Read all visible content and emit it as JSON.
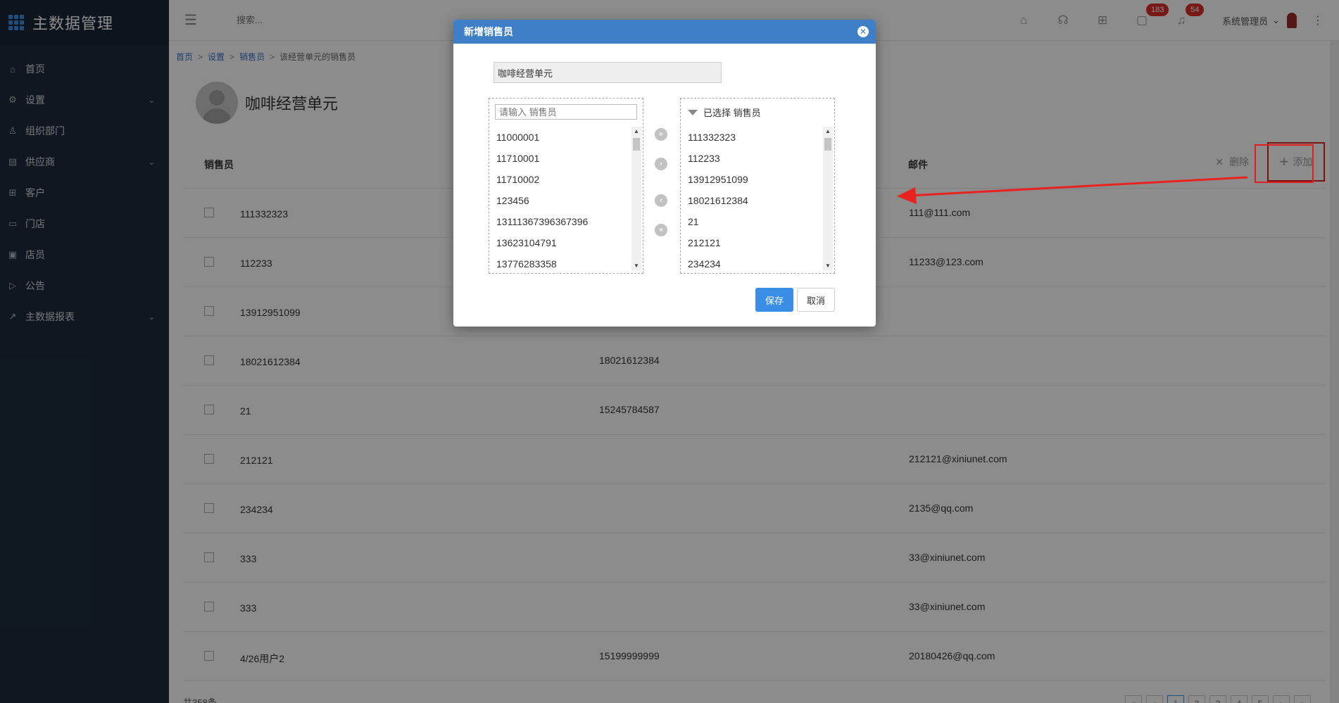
{
  "app": {
    "title": "主数据管理"
  },
  "sidebar": {
    "items": [
      {
        "label": "首页",
        "icon": "home-icon",
        "chevron": false
      },
      {
        "label": "设置",
        "icon": "gear-icon",
        "chevron": true
      },
      {
        "label": "组织部门",
        "icon": "org-icon",
        "chevron": false
      },
      {
        "label": "供应商",
        "icon": "supplier-icon",
        "chevron": true
      },
      {
        "label": "客户",
        "icon": "customer-icon",
        "chevron": false
      },
      {
        "label": "门店",
        "icon": "store-icon",
        "chevron": false
      },
      {
        "label": "店员",
        "icon": "clerk-icon",
        "chevron": false
      },
      {
        "label": "公告",
        "icon": "announcement-icon",
        "chevron": false
      },
      {
        "label": "主数据报表",
        "icon": "chart-icon",
        "chevron": true
      }
    ]
  },
  "header": {
    "search_placeholder": "搜索...",
    "badge_messages": "183",
    "badge_notifications": "54",
    "user": "系统管理员"
  },
  "breadcrumb": {
    "home": "首页",
    "settings": "设置",
    "sales": "销售员",
    "current": "该经营单元的销售员"
  },
  "page": {
    "unit_name": "咖啡经营单元"
  },
  "table": {
    "headers": {
      "salesperson": "销售员",
      "email": "邮件"
    },
    "delete_label": "删除",
    "add_label": "添加",
    "rows": [
      {
        "name": "111332323",
        "phone": "",
        "email": "111@111.com"
      },
      {
        "name": "112233",
        "phone": "",
        "email": "11233@123.com"
      },
      {
        "name": "13912951099",
        "phone": "",
        "email": ""
      },
      {
        "name": "18021612384",
        "phone": "18021612384",
        "email": ""
      },
      {
        "name": "21",
        "phone": "15245784587",
        "email": ""
      },
      {
        "name": "212121",
        "phone": "",
        "email": "212121@xiniunet.com"
      },
      {
        "name": "234234",
        "phone": "",
        "email": "2135@qq.com"
      },
      {
        "name": "333",
        "phone": "",
        "email": "33@xiniunet.com"
      },
      {
        "name": "333",
        "phone": "",
        "email": "33@xiniunet.com"
      },
      {
        "name": "4/26用户2",
        "phone": "15199999999",
        "email": "20180426@qq.com"
      }
    ],
    "total": "共358条"
  },
  "pager": {
    "pages": [
      "1",
      "2",
      "3",
      "4",
      "5"
    ],
    "current": "1"
  },
  "modal": {
    "title": "新增销售员",
    "unit_value": "咖啡经营单元",
    "filter_placeholder": "请输入 销售员",
    "selected_header": "已选择 销售员",
    "available": [
      "11000001",
      "11710001",
      "11710002",
      "123456",
      "13111367396367396",
      "13623104791",
      "13776283358"
    ],
    "selected": [
      "111332323",
      "112233",
      "13912951099",
      "18021612384",
      "21",
      "212121",
      "234234"
    ],
    "save_label": "保存",
    "cancel_label": "取消"
  },
  "colors": {
    "sidebar": "#1e2b3b",
    "accent": "#3a8ee6",
    "modal_header": "#3f7fc8",
    "highlight": "#e02020"
  }
}
